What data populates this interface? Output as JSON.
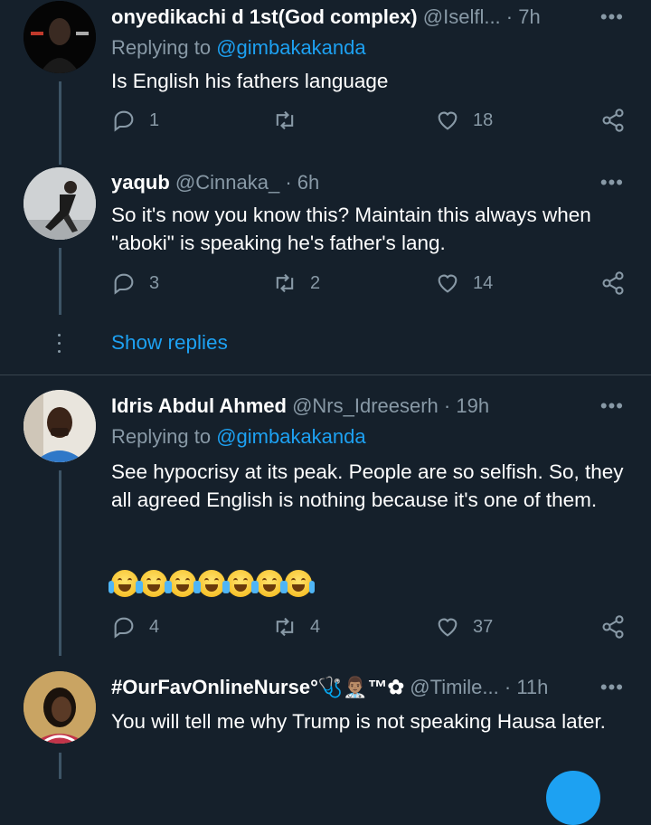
{
  "tweets": [
    {
      "name": "onyedikachi d 1st(God complex)",
      "handle": "@Iselfl...",
      "time": "· 7h",
      "replying_prefix": "Replying to ",
      "replying_to": "@gimbakakanda",
      "text": "Is English his fathers language",
      "replies": "1",
      "retweets": "",
      "likes": "18"
    },
    {
      "name": "yaqub",
      "handle": "@Cinnaka_",
      "time": "· 6h",
      "text": "So it's now you know this? Maintain this always when \"aboki\" is speaking he's father's lang.",
      "replies": "3",
      "retweets": "2",
      "likes": "14"
    },
    {
      "name": "Idris Abdul Ahmed",
      "handle": "@Nrs_Idreeserh",
      "time": "· 19h",
      "replying_prefix": "Replying to ",
      "replying_to": "@gimbakakanda",
      "text": "See hypocrisy at its peak. People are so selfish. So, they all agreed English is nothing because it's one of them.",
      "emoji": "😂😂😂😂😂😂😂",
      "replies": "4",
      "retweets": "4",
      "likes": "37"
    },
    {
      "name": "#OurFavOnlineNurse",
      "name_suffix": "°🩺👨🏽‍⚕️™✿",
      "handle": "@Timile...",
      "time": "· 11h",
      "text": "You will tell me why Trump is not speaking Hausa later."
    }
  ],
  "show_replies": "Show replies",
  "more_glyph": "•••",
  "icons": {
    "reply": "reply-icon",
    "retweet": "retweet-icon",
    "like": "heart-icon",
    "share": "share-icon",
    "more": "more-icon"
  },
  "colors": {
    "background": "#15202b",
    "text": "#ffffff",
    "muted": "#8899a6",
    "link": "#1da1f2",
    "divider": "#38444d"
  }
}
